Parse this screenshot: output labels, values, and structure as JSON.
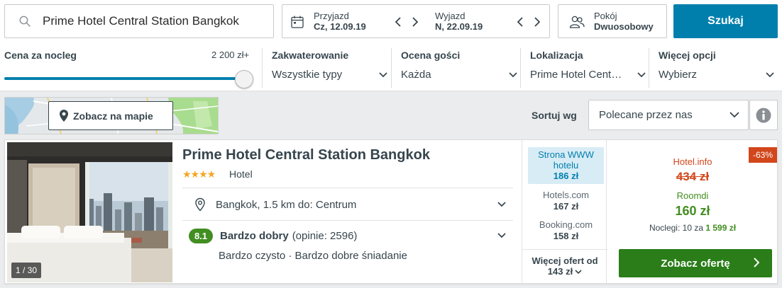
{
  "search": {
    "value": "Prime Hotel Central Station Bangkok"
  },
  "dates": {
    "checkin_label": "Przyjazd",
    "checkin_value": "Cz, 12.09.19",
    "checkout_label": "Wyjazd",
    "checkout_value": "N, 22.09.19"
  },
  "room": {
    "label": "Pokój",
    "value": "Dwuosobowy"
  },
  "search_button": "Szukaj",
  "filters": {
    "price_label": "Cena za nocleg",
    "price_max": "2 200 zł+",
    "price_slider_level": 1.0,
    "accommodation_label": "Zakwaterowanie",
    "accommodation_value": "Wszystkie typy",
    "rating_label": "Ocena gości",
    "rating_value": "Każda",
    "location_label": "Lokalizacja",
    "location_value": "Prime Hotel Cent…",
    "more_label": "Więcej opcji",
    "more_value": "Wybierz"
  },
  "map": {
    "button": "Zobacz na mapie"
  },
  "sort": {
    "label": "Sortuj wg",
    "value": "Polecane przez nas"
  },
  "hotel": {
    "name": "Prime Hotel Central Station Bangkok",
    "stars": "★★★★",
    "star_count": 4,
    "type": "Hotel",
    "location": "Bangkok, 1.5 km do: Centrum",
    "rating_score": "8.1",
    "rating_word": "Bardzo dobry",
    "rating_count": "(opinie: 2596)",
    "rating_details": "Bardzo czysto · Bardzo dobre śniadanie",
    "photo_count": "1 / 30"
  },
  "offers": {
    "highlight_name": "Strona WWW hotelu",
    "highlight_price": "186 zł",
    "items": [
      {
        "name": "Hotels.com",
        "price": "167 zł"
      },
      {
        "name": "Booking.com",
        "price": "158 zł"
      }
    ],
    "more_line1": "Więcej ofert od",
    "more_line2": "143 zł"
  },
  "best_deal": {
    "discount": "-63%",
    "site_old": "Hotel.info",
    "old_price": "434 zł",
    "site_new": "Roomdi",
    "new_price": "160 zł",
    "nights_prefix": "Noclegi: 10 za",
    "nights_total": "1 599 zł",
    "cta": "Zobacz ofertę"
  },
  "colors": {
    "primary": "#007fad",
    "green": "#428e21",
    "cta_green": "#2a7d18",
    "red": "#d2461c",
    "star": "#f5a623"
  }
}
